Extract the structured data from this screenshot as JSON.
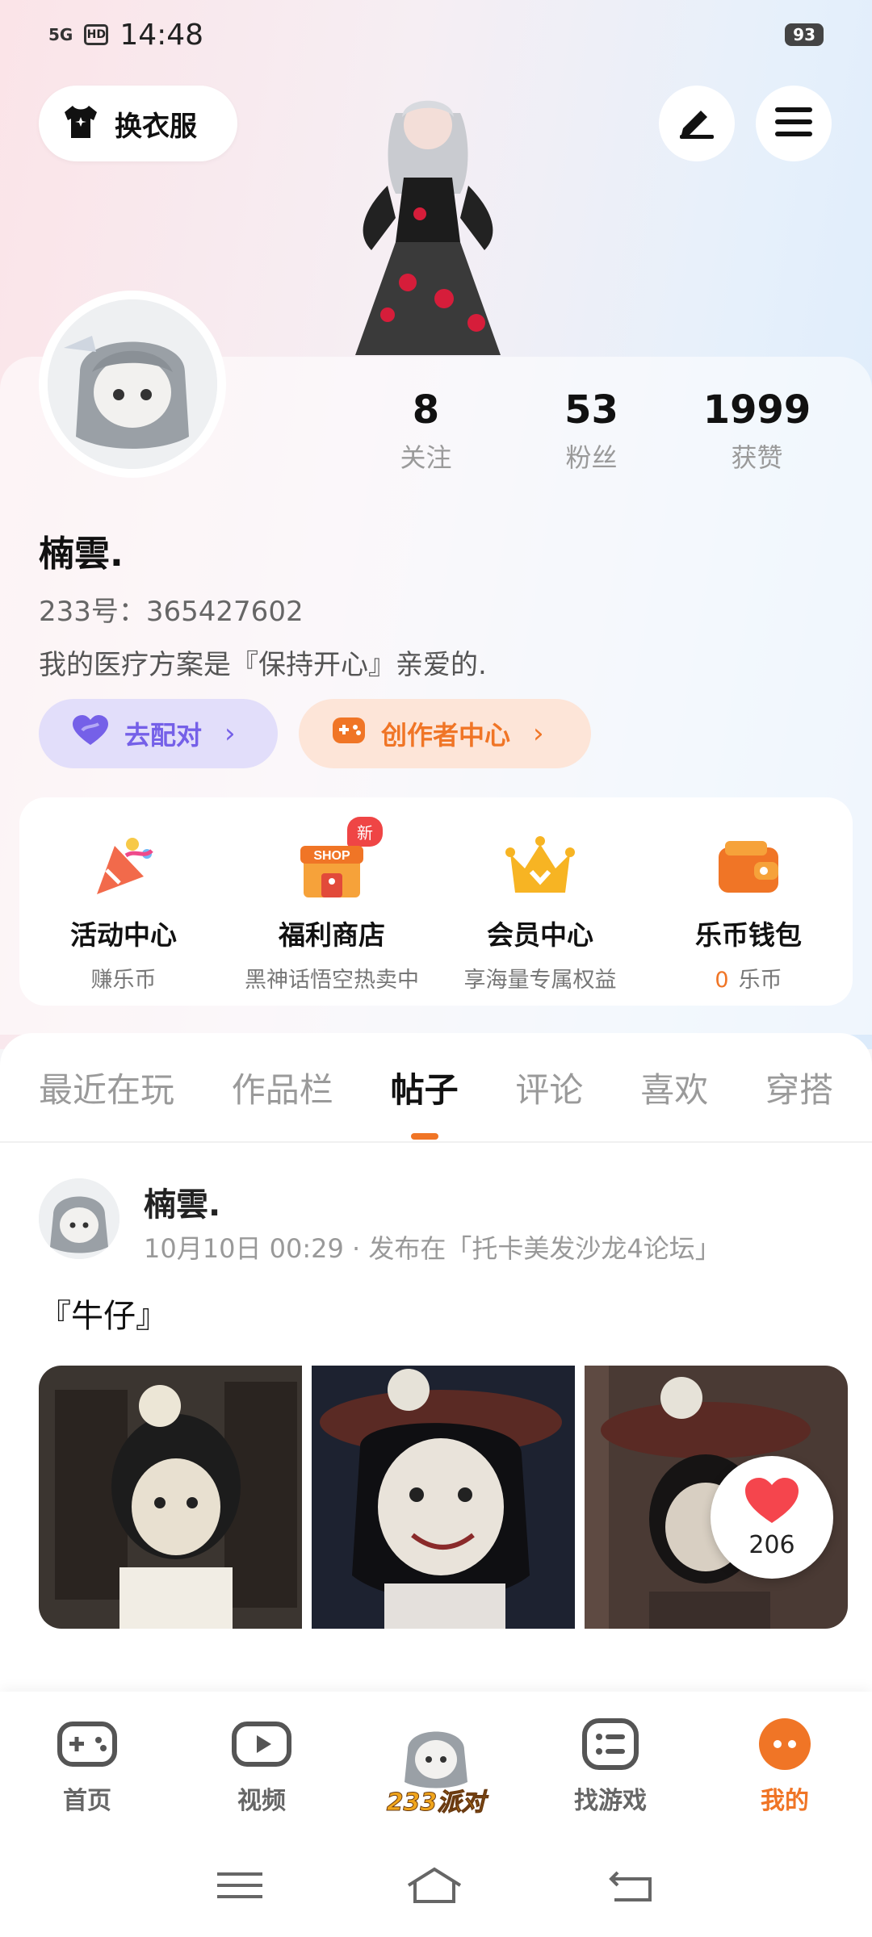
{
  "status_bar": {
    "network": "5G",
    "hd": "HD",
    "time": "14:48",
    "battery": "93"
  },
  "header": {
    "dress_label": "换衣服"
  },
  "profile": {
    "stats": [
      {
        "num": "8",
        "label": "关注"
      },
      {
        "num": "53",
        "label": "粉丝"
      },
      {
        "num": "1999",
        "label": "获赞"
      }
    ],
    "name": "楠雲.",
    "uid": "233号：365427602",
    "bio": "我的医疗方案是『保持开心』亲爱的.",
    "match_label": "去配对",
    "creator_label": "创作者中心"
  },
  "features": [
    {
      "title": "活动中心",
      "sub": "赚乐币"
    },
    {
      "title": "福利商店",
      "sub": "黑神话悟空热卖中",
      "badge": "新",
      "shop": "SHOP"
    },
    {
      "title": "会员中心",
      "sub": "享海量专属权益"
    },
    {
      "title": "乐币钱包",
      "zero": "0",
      "sub": "乐币"
    }
  ],
  "tabs": [
    "最近在玩",
    "作品栏",
    "帖子",
    "评论",
    "喜欢",
    "穿搭"
  ],
  "post": {
    "author": "楠雲.",
    "meta": "10月10日  00:29 · 发布在「托卡美发沙龙4论坛」",
    "title": "『牛仔』",
    "likes": "206"
  },
  "bottom_nav": [
    {
      "label": "首页"
    },
    {
      "label": "视频"
    },
    {
      "label": "233派对"
    },
    {
      "label": "找游戏"
    },
    {
      "label": "我的"
    }
  ],
  "colors": {
    "accent": "#f07526",
    "match": "#7560e8",
    "like": "#f5454d"
  }
}
